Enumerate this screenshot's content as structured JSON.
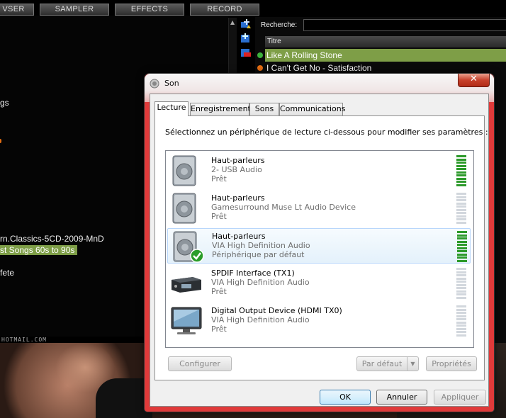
{
  "dj_app": {
    "tabs": [
      "VSER",
      "SAMPLER",
      "EFFECTS",
      "RECORD"
    ],
    "left_items": [
      "gs",
      "rn.Classics-5CD-2009-MnD",
      "st Songs 60s to 90s",
      "fete"
    ],
    "search_label": "Recherche:",
    "search_value": "",
    "column_header": "Titre",
    "tracks": [
      {
        "title": "Like A Rolling Stone",
        "dot_color": "#3db13d"
      },
      {
        "title": "I Can't Get No - Satisfaction",
        "dot_color": "#e56d12"
      }
    ],
    "email_text": "HOTMAIL.COM"
  },
  "dialog": {
    "title": "Son",
    "close_label": "✕",
    "tabs": [
      "Lecture",
      "Enregistrement",
      "Sons",
      "Communications"
    ],
    "instruction": "Sélectionnez un périphérique de lecture ci-dessous pour modifier ses paramètres :",
    "devices": [
      {
        "name": "Haut-parleurs",
        "sub": "2- USB Audio",
        "status": "Prêt",
        "icon": "speaker-icon",
        "level": 1.0
      },
      {
        "name": "Haut-parleurs",
        "sub": "Gamesurround Muse Lt Audio Device",
        "status": "Prêt",
        "icon": "speaker-icon",
        "level": 0.0
      },
      {
        "name": "Haut-parleurs",
        "sub": "VIA High Definition Audio",
        "status": "Périphérique par défaut",
        "icon": "speaker-default-icon",
        "level": 1.0
      },
      {
        "name": "SPDIF Interface (TX1)",
        "sub": "VIA High Definition Audio",
        "status": "Prêt",
        "icon": "spdif-device-icon",
        "level": 0.0
      },
      {
        "name": "Digital Output Device (HDMI TX0)",
        "sub": "VIA High Definition Audio",
        "status": "Prêt",
        "icon": "monitor-icon",
        "level": 0.0
      }
    ],
    "buttons": {
      "configure": "Configurer",
      "set_default": "Par défaut",
      "properties": "Propriétés",
      "ok": "OK",
      "cancel": "Annuler",
      "apply": "Appliquer"
    }
  }
}
